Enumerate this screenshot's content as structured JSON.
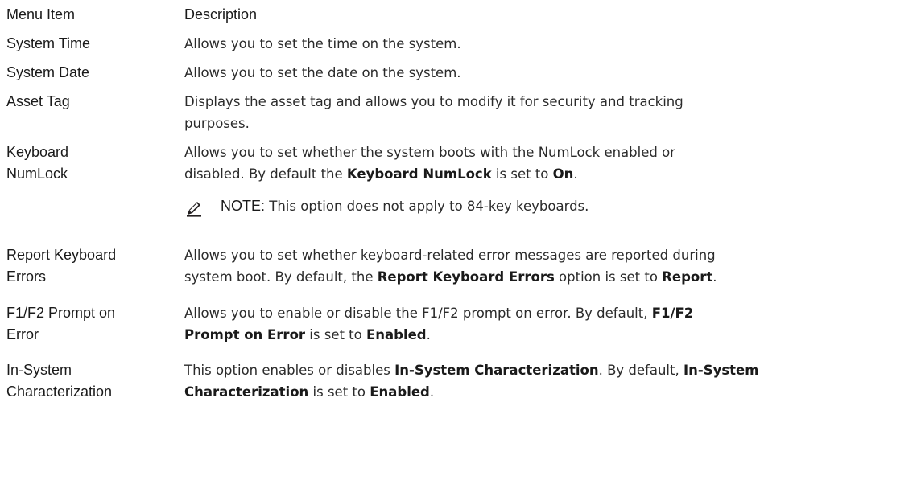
{
  "header": {
    "item": "Menu Item",
    "description": "Description"
  },
  "rows": [
    {
      "item": "System Time",
      "desc": "Allows you to set the time on the system."
    },
    {
      "item": "System Date",
      "desc": "Allows you to set the date on the system."
    },
    {
      "item": "Asset Tag",
      "desc_line1": "Displays the asset tag and allows you to modify it for security and tracking",
      "desc_line2": "purposes."
    },
    {
      "item_line1": "Keyboard",
      "item_line2": "NumLock",
      "desc_line1": "Allows you to set whether the system boots with the NumLock enabled or",
      "desc_line2_a": "disabled. By default the ",
      "desc_line2_b": "Keyboard NumLock",
      "desc_line2_c": " is set to ",
      "desc_line2_d": "On",
      "desc_line2_e": ".",
      "note_label": "NOTE:",
      "note_text": " This option does not apply to 84-key keyboards."
    },
    {
      "item_line1": "Report Keyboard",
      "item_line2": "Errors",
      "desc_line1": "Allows you to set whether keyboard-related error messages are reported during",
      "desc_line2_a": "system boot. By default, the ",
      "desc_line2_b": "Report Keyboard Errors",
      "desc_line2_c": " option is set to ",
      "desc_line2_d": "Report",
      "desc_line2_e": "."
    },
    {
      "item_line1": "F1/F2 Prompt on",
      "item_line2": "Error",
      "desc_line1_a": "Allows you to enable or disable the F1/F2 prompt on error. By default, ",
      "desc_line1_b": "F1/F2",
      "desc_line2_a": "Prompt on Error",
      "desc_line2_b": " is set to ",
      "desc_line2_c": "Enabled",
      "desc_line2_d": "."
    },
    {
      "item_line1": "In-System",
      "item_line2": "Characterization",
      "desc_line1_a": "This option enables or disables ",
      "desc_line1_b": "In-System Characterization",
      "desc_line1_c": ". By default, ",
      "desc_line1_d": "In-System",
      "desc_line2_a": "Characterization",
      "desc_line2_b": " is set to ",
      "desc_line2_c": "Enabled",
      "desc_line2_d": "."
    }
  ],
  "colors": {
    "text": "#231f20",
    "icon": "#231f20"
  }
}
